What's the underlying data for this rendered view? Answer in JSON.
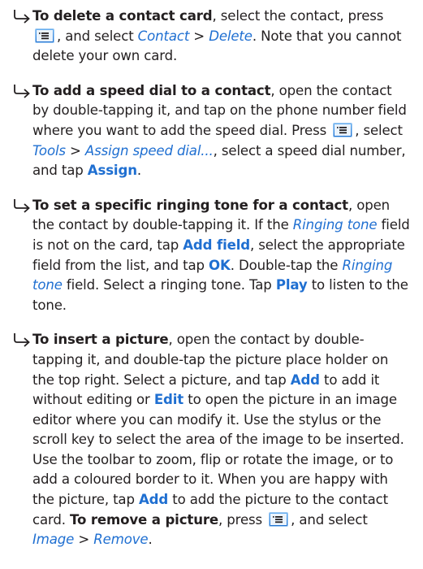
{
  "icons": {
    "bullet": "hooked-arrow-icon",
    "menu_key": "menu-key-icon"
  },
  "colors": {
    "ui_text": "#1f6fd1",
    "body_text": "#231f20",
    "key_gradient_top": "#6db3f2",
    "key_gradient_bottom": "#1e6fcf"
  },
  "steps": [
    {
      "lead": "To delete a contact card",
      "t1": ", select the contact, press ",
      "t2": ", and select ",
      "menu1": "Contact",
      "sep1": " > ",
      "menu2": "Delete",
      "t3": ". Note that you cannot delete your own card."
    },
    {
      "lead": "To add a speed dial to a contact",
      "t1": ", open the contact by double-tapping it, and tap on the phone number field where you want to add the speed dial. Press ",
      "t2": ", select ",
      "menu1": "Tools",
      "sep1": " > ",
      "menu2": "Assign speed dial...",
      "t3": ", select a speed dial number, and tap ",
      "btn1": "Assign",
      "t4": "."
    },
    {
      "lead": "To set a specific ringing tone for a contact",
      "t1": ", open the contact by double-tapping it. If the ",
      "field1": "Ringing tone",
      "t2": " field is not on the card, tap ",
      "btn1": "Add field",
      "t3": ", select the appropriate field from the list, and tap ",
      "btn2": "OK",
      "t4": ". Double-tap the ",
      "field2": "Ringing tone",
      "t5": " field. Select a ringing tone. Tap ",
      "btn3": "Play",
      "t6": " to listen to the tone."
    },
    {
      "lead": "To insert a picture",
      "t1": ", open the contact by double-tapping it, and double-tap the picture place holder on the top right. Select a picture, and tap ",
      "btn1": "Add",
      "t2": " to add it without editing or ",
      "btn2": "Edit",
      "t3": " to open the picture in an image editor where you can modify it. Use the stylus or the scroll key to select the area of the image to be inserted. Use the toolbar to zoom, flip or rotate the image, or to add a coloured border to it. When you are happy with the picture, tap ",
      "btn3": "Add",
      "t4": " to add the picture to the contact card. ",
      "lead2": "To remove a picture",
      "t5": ", press ",
      "t6": ", and select ",
      "menu1": "Image",
      "sep1": " > ",
      "menu2": "Remove",
      "t7": "."
    }
  ]
}
